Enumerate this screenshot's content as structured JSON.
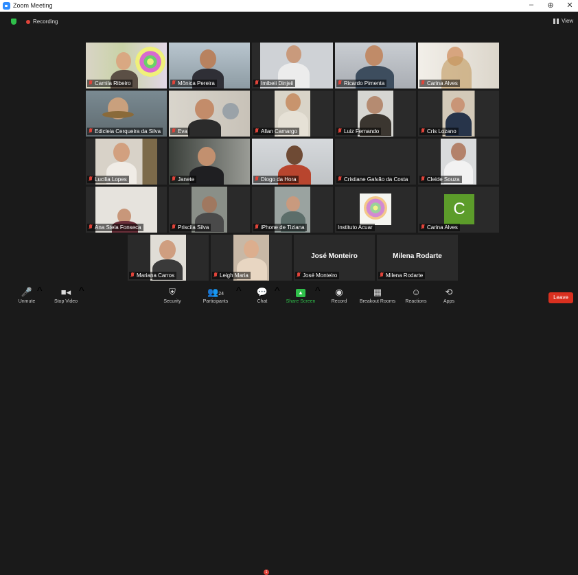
{
  "window": {
    "title": "Zoom Meeting",
    "minimize": "–",
    "maximize": "⊕",
    "close": "✕"
  },
  "topbar": {
    "recording": "Recording",
    "view": "View"
  },
  "participants": [
    {
      "name": "Camila Ribeiro"
    },
    {
      "name": "Mônica Pereira"
    },
    {
      "name": "Imibeii Dinjeii"
    },
    {
      "name": "Ricardo Pimenta"
    },
    {
      "name": "Carina Alves"
    },
    {
      "name": "Edicleia Cerqueira da Silva"
    },
    {
      "name": "Eva"
    },
    {
      "name": "Allan Camargo"
    },
    {
      "name": "Luiz Fernando"
    },
    {
      "name": "Cris Lozano"
    },
    {
      "name": "Lucilia Lopes"
    },
    {
      "name": "Janete"
    },
    {
      "name": "Diogo da Hora"
    },
    {
      "name": "Cristiane Galvão da Costa"
    },
    {
      "name": "Cleide Souza"
    },
    {
      "name": "Ana Stela Fonseca"
    },
    {
      "name": "Priscila Silva"
    },
    {
      "name": "iPhone de Tiziana"
    },
    {
      "name": "Instituto Acuar"
    },
    {
      "name": "Carina Alves",
      "initial": "C"
    },
    {
      "name": "Mariana Carros"
    },
    {
      "name": "Leigh Maria"
    },
    {
      "name": "José Monteiro",
      "display": "José Monteiro"
    },
    {
      "name": "Milena Rodarte",
      "display": "Milena Rodarte"
    }
  ],
  "toolbar": {
    "unmute": "Unmute",
    "stop_video": "Stop Video",
    "security": "Security",
    "participants": "Participants",
    "participants_count": "24",
    "chat": "Chat",
    "chat_badge": "1",
    "share_screen": "Share Screen",
    "record": "Record",
    "breakout_rooms": "Breakout Rooms",
    "reactions": "Reactions",
    "apps": "Apps",
    "leave": "Leave"
  },
  "colors": {
    "accent": "#2d8cff",
    "leave": "#d9301f",
    "active_speaker": "#d4d43a",
    "muted": "#e0443a"
  }
}
